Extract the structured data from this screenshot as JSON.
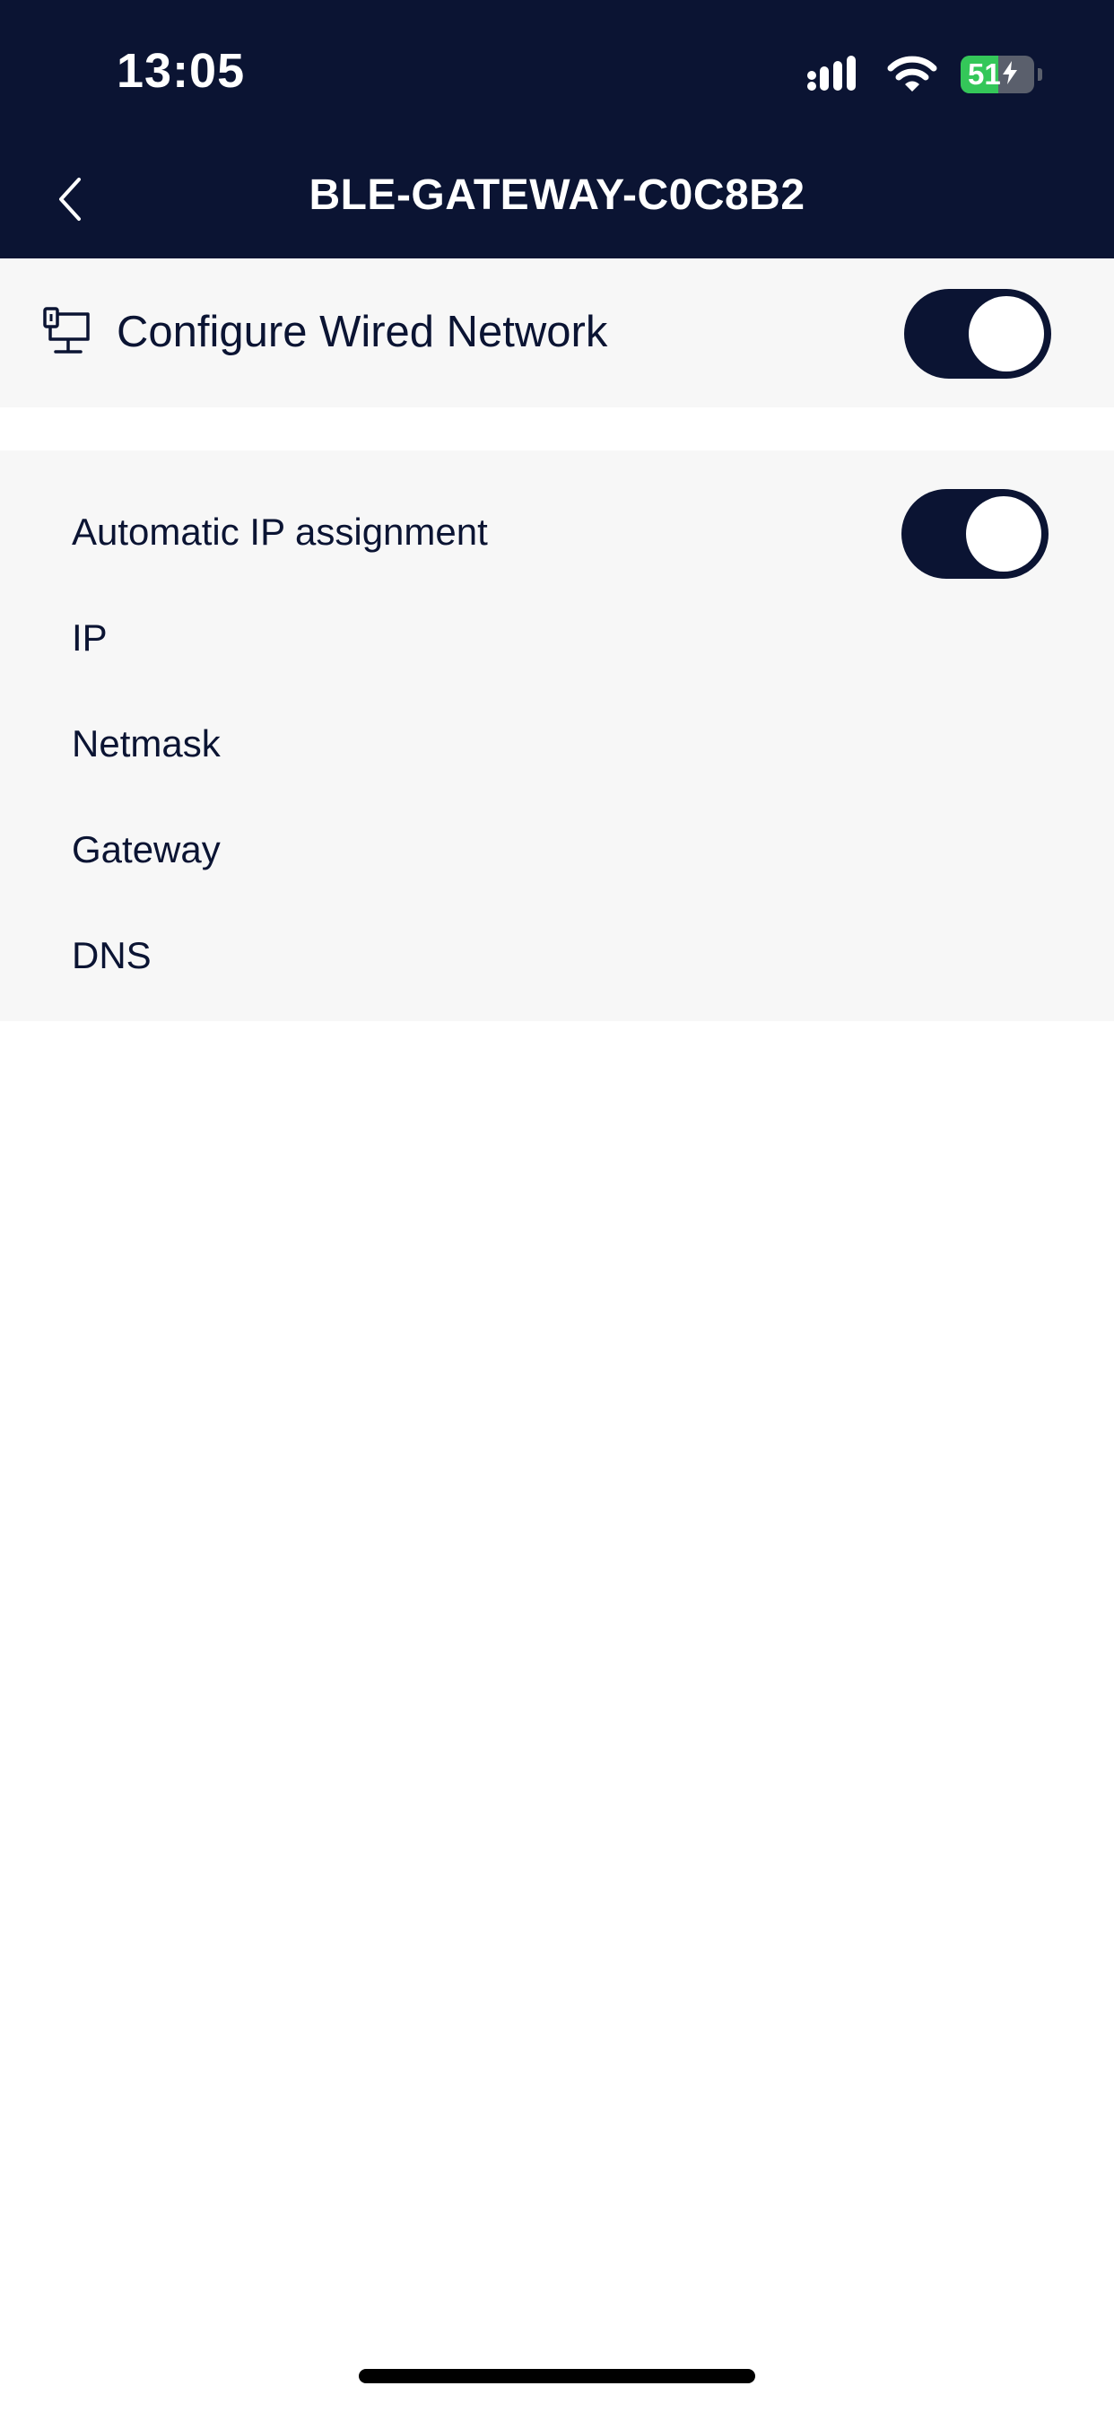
{
  "status_bar": {
    "time": "13:05",
    "battery_level": "51",
    "battery_fraction": 0.51,
    "charging": true
  },
  "nav": {
    "title": "BLE-GATEWAY-C0C8B2",
    "back_icon": "chevron-left-icon"
  },
  "wired": {
    "label": "Configure Wired Network",
    "icon": "wired-network-icon",
    "enabled": true
  },
  "settings": {
    "auto_ip_label": "Automatic IP assignment",
    "auto_ip_enabled": true,
    "rows": [
      "IP",
      "Netmask",
      "Gateway",
      "DNS"
    ]
  },
  "colors": {
    "primary": "#0b1433",
    "card_bg": "#f7f7f7",
    "battery_green": "#34c759"
  }
}
